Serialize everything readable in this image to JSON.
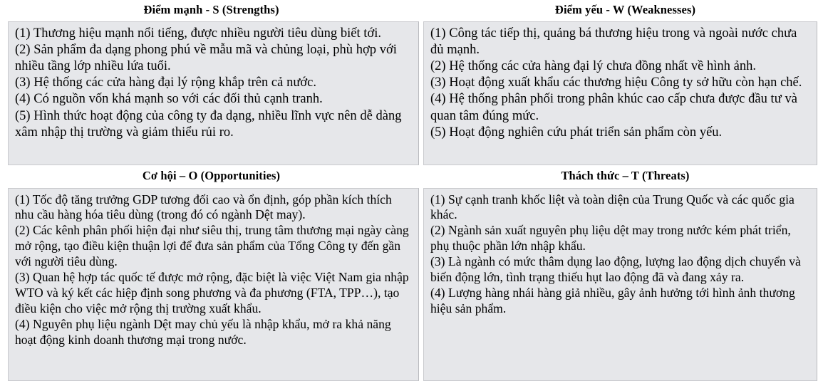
{
  "document": {
    "type": "SWOT analysis table",
    "language": "vi"
  },
  "quadrants": [
    {
      "key": "strengths",
      "title": "Điểm mạnh - S (Strengths)",
      "items": [
        "(1) Thương hiệu mạnh nổi tiếng, được nhiều người tiêu dùng biết tới.",
        "(2) Sản phẩm đa dạng phong phú về mẫu mã và chủng loại, phù hợp với nhiều tầng lớp nhiều lứa tuổi.",
        "(3) Hệ thống các cửa hàng đại lý rộng khắp trên cả nước.",
        "(4) Có nguồn vốn khá mạnh so với các đối thủ cạnh tranh.",
        "(5) Hình thức hoạt động của công ty đa dạng, nhiều lĩnh vực nên dễ dàng xâm nhập thị trường và giảm thiểu rủi ro."
      ]
    },
    {
      "key": "weaknesses",
      "title": "Điểm yếu - W (Weaknesses)",
      "items": [
        "(1) Công tác tiếp thị, quảng bá thương hiệu trong và ngoài nước chưa đủ mạnh.",
        "(2) Hệ thống các cửa hàng đại lý chưa đồng nhất về hình ảnh.",
        "(3) Hoạt động xuất khẩu các thương hiệu Công ty sở hữu còn hạn chế.",
        "(4) Hệ thống phân phối trong phân khúc cao cấp chưa được đầu tư và quan tâm đúng mức.",
        "(5) Hoạt động nghiên cứu phát triển sản phẩm còn yếu."
      ]
    },
    {
      "key": "opportunities",
      "title": "Cơ hội – O (Opportunities)",
      "items": [
        "(1) Tốc độ tăng trưởng GDP tương đối cao và ổn định, góp phần kích thích nhu cầu hàng hóa tiêu dùng (trong đó có ngành Dệt may).",
        "(2) Các kênh phân phối hiện đại như siêu thị, trung tâm thương mại ngày càng mở rộng, tạo điều kiện thuận lợi để đưa sản phẩm của Tổng Công ty đến gần với người tiêu dùng.",
        "(3) Quan hệ hợp tác quốc tế được mở rộng, đặc biệt là việc Việt Nam gia nhập WTO và ký kết các hiệp định song phương và đa phương (FTA, TPP…), tạo điều kiện cho việc mở rộng thị trường xuất khẩu.",
        "(4) Nguyên phụ liệu ngành Dệt may chủ yếu là nhập khẩu, mở ra khả năng hoạt động kinh doanh thương mại trong nước."
      ]
    },
    {
      "key": "threats",
      "title": "Thách thức – T (Threats)",
      "items": [
        "(1) Sự cạnh tranh khốc liệt và toàn diện của Trung Quốc và các quốc gia khác.",
        "(2) Ngành sản xuất nguyên phụ liệu dệt may trong nước kém phát triển, phụ thuộc phần lớn nhập khẩu.",
        "(3) Là ngành có mức thâm dụng lao động, lượng lao động dịch chuyển và biến động lớn, tình trạng thiếu hụt lao động đã và đang xảy ra.",
        "(4) Lượng hàng nhái hàng giả nhiều, gây ảnh hưởng tới hình ảnh thương hiệu sản phẩm."
      ]
    }
  ],
  "colors": {
    "cell_background": "#e6e7ea",
    "cell_border": "#c9cace",
    "text": "#000000",
    "page_background": "#ffffff"
  }
}
